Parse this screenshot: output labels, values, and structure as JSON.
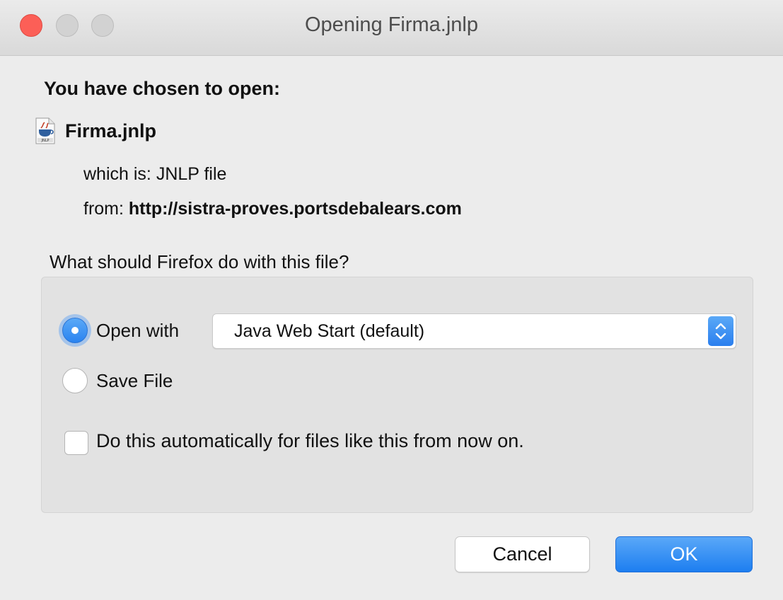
{
  "window": {
    "title": "Opening Firma.jnlp",
    "traffic_lights": {
      "close_color": "#fc5f57",
      "inactive_color": "#d2d2d2"
    }
  },
  "dialog": {
    "heading": "You have chosen to open:",
    "file": {
      "icon": "jnlp-java-file-icon",
      "name": "Firma.jnlp",
      "type_label": "which is:",
      "type_value": "JNLP file",
      "source_label": "from:",
      "source_value": "http://sistra-proves.portsdebalears.com"
    },
    "question": "What should Firefox do with this file?",
    "options": {
      "open_with": {
        "label": "Open with",
        "selected": true,
        "app_value": "Java Web Start (default)"
      },
      "save_file": {
        "label": "Save File",
        "selected": false
      },
      "auto": {
        "label": "Do this automatically for files like this from now on.",
        "checked": false
      }
    },
    "buttons": {
      "cancel": "Cancel",
      "ok": "OK"
    },
    "accent_color": "#2a83f0"
  }
}
